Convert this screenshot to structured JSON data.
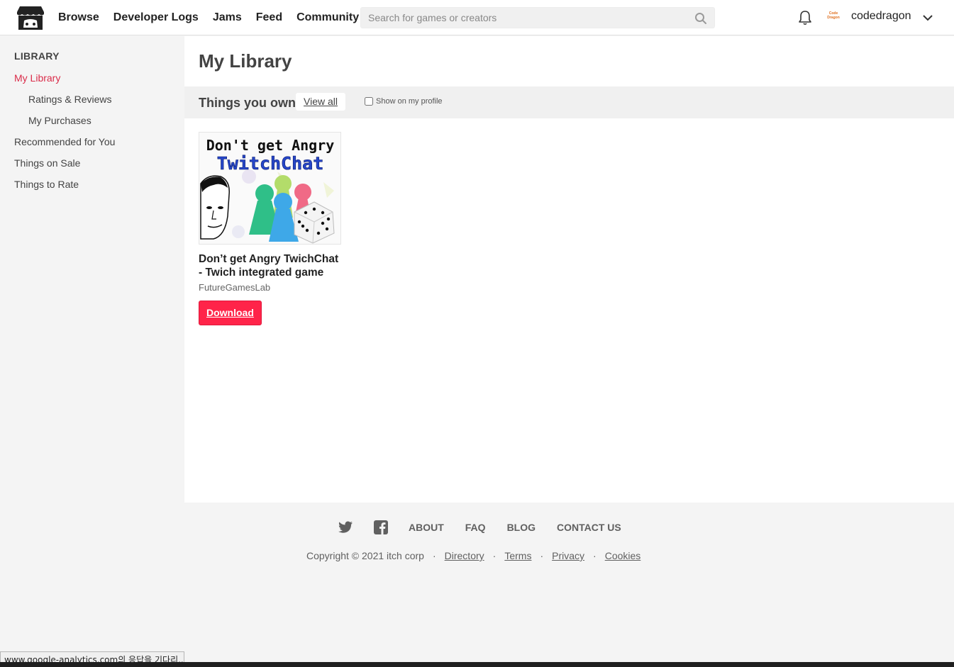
{
  "header": {
    "nav": [
      "Browse",
      "Developer Logs",
      "Jams",
      "Feed",
      "Community"
    ],
    "search_placeholder": "Search for games or creators",
    "avatar_text": "Code Dragon",
    "username": "codedragon"
  },
  "sidebar": {
    "heading": "LIBRARY",
    "items": [
      {
        "label": "My Library",
        "active": true
      },
      {
        "label": "Ratings & Reviews"
      },
      {
        "label": "My Purchases"
      },
      {
        "label": "Recommended for You"
      },
      {
        "label": "Things on Sale"
      },
      {
        "label": "Things to Rate"
      }
    ]
  },
  "main": {
    "title": "My Library",
    "section_title": "Things you own",
    "view_all": "View all",
    "show_on_profile": "Show on my profile",
    "game": {
      "thumb_line1": "Don't get Angry",
      "thumb_line2": "TwitchChat",
      "title": "Don’t get Angry TwichChat - Twich integrated game",
      "author": "FutureGamesLab",
      "download": "Download"
    }
  },
  "footer": {
    "links": [
      "ABOUT",
      "FAQ",
      "BLOG",
      "CONTACT US"
    ],
    "copyright": "Copyright © 2021 itch corp",
    "legal_links": [
      "Directory",
      "Terms",
      "Privacy",
      "Cookies"
    ]
  },
  "status_bar": "www.google-analytics.com의 응답을 기다리...",
  "colors": {
    "accent": "#da2c49",
    "download_button": "#ff2449"
  }
}
